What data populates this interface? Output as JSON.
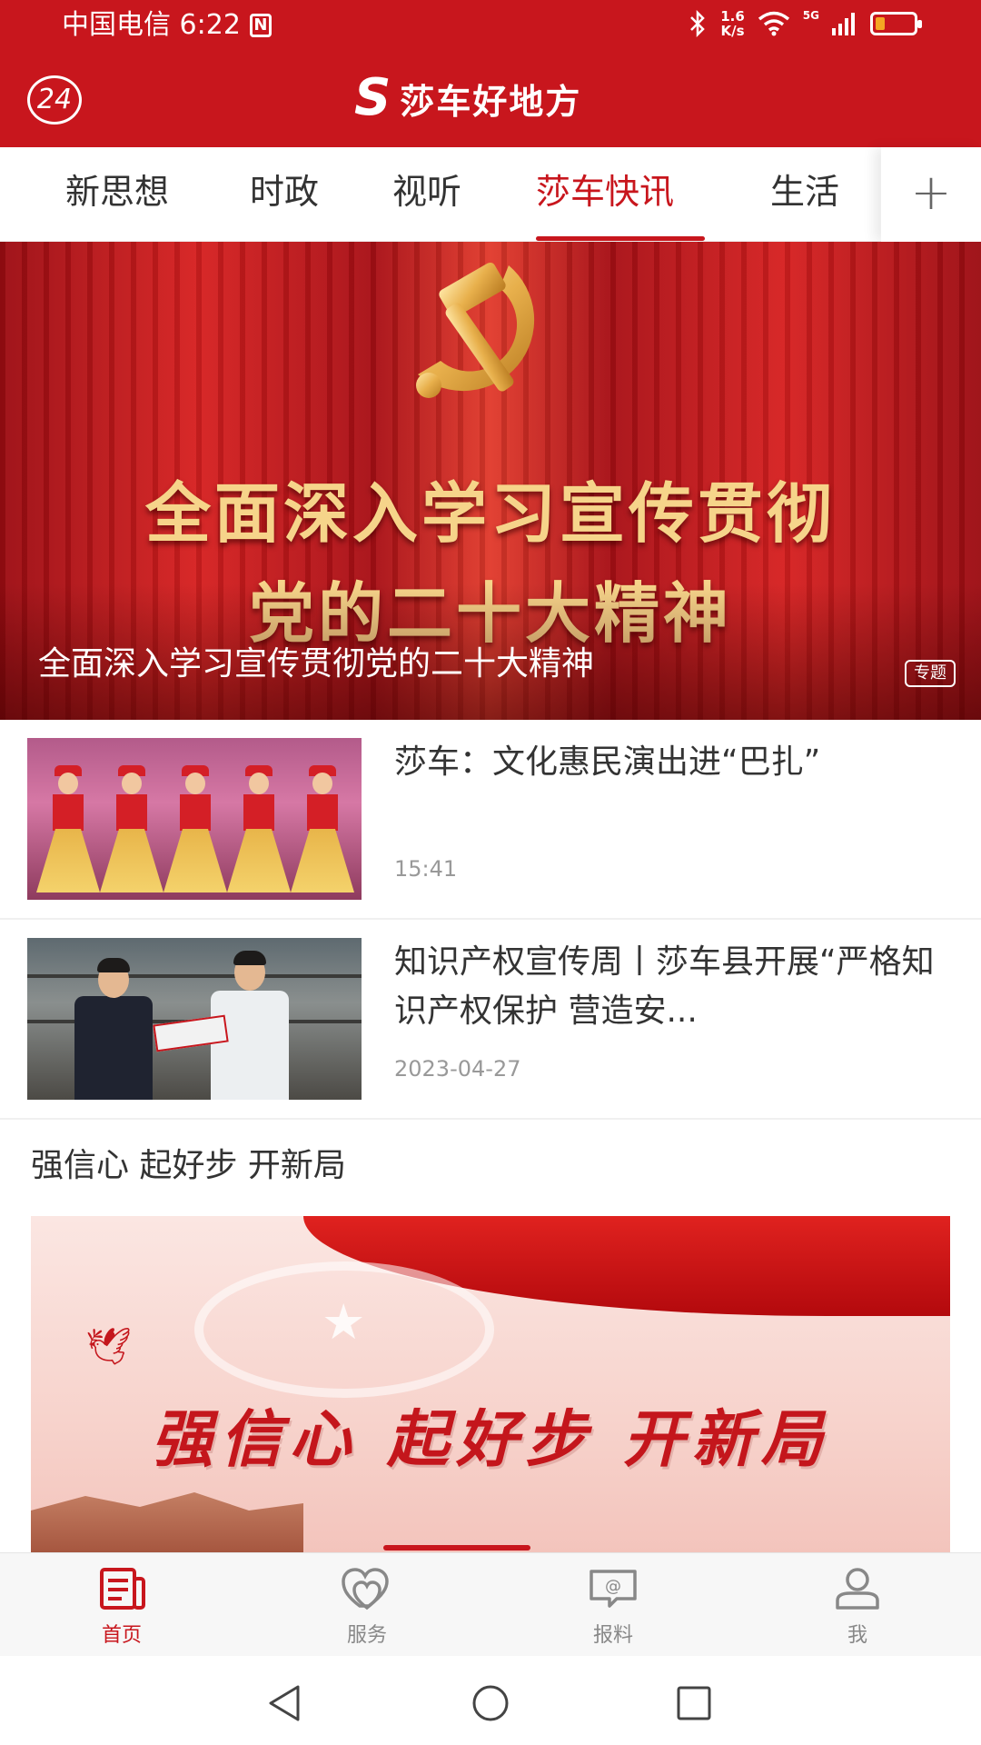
{
  "status_bar": {
    "carrier_time": "中国电信 6:22",
    "nfc": "N",
    "speed_top": "1.6",
    "speed_bottom": "K/s",
    "network": "5G",
    "battery_level": 0.25
  },
  "header": {
    "badge": "24",
    "app_name": "莎车好地方",
    "brand_color": "#c8161d"
  },
  "tabs": [
    {
      "label": "新思想",
      "active": false
    },
    {
      "label": "时政",
      "active": false
    },
    {
      "label": "视听",
      "active": false
    },
    {
      "label": "莎车快讯",
      "active": true
    },
    {
      "label": "生活",
      "active": false
    }
  ],
  "tab_add_icon": "+",
  "hero": {
    "line1": "全面深入学习宣传贯彻",
    "line2": "党的二十大精神",
    "caption": "全面深入学习宣传贯彻党的二十大精神",
    "tag": "专题"
  },
  "news": [
    {
      "title": "莎车：文化惠民演出进“巴扎”",
      "time": "15:41"
    },
    {
      "title": "知识产权宣传周丨莎车县开展“严格知识产权保护 营造安...",
      "time": "2023-04-27"
    }
  ],
  "section": {
    "title": "强信心 起好步 开新局",
    "banner_text": "强信心 起好步 开新局"
  },
  "bottom_nav": [
    {
      "label": "首页",
      "icon": "news-icon",
      "active": true
    },
    {
      "label": "服务",
      "icon": "heart-icon",
      "active": false
    },
    {
      "label": "报料",
      "icon": "report-icon",
      "active": false
    },
    {
      "label": "我",
      "icon": "user-icon",
      "active": false
    }
  ]
}
